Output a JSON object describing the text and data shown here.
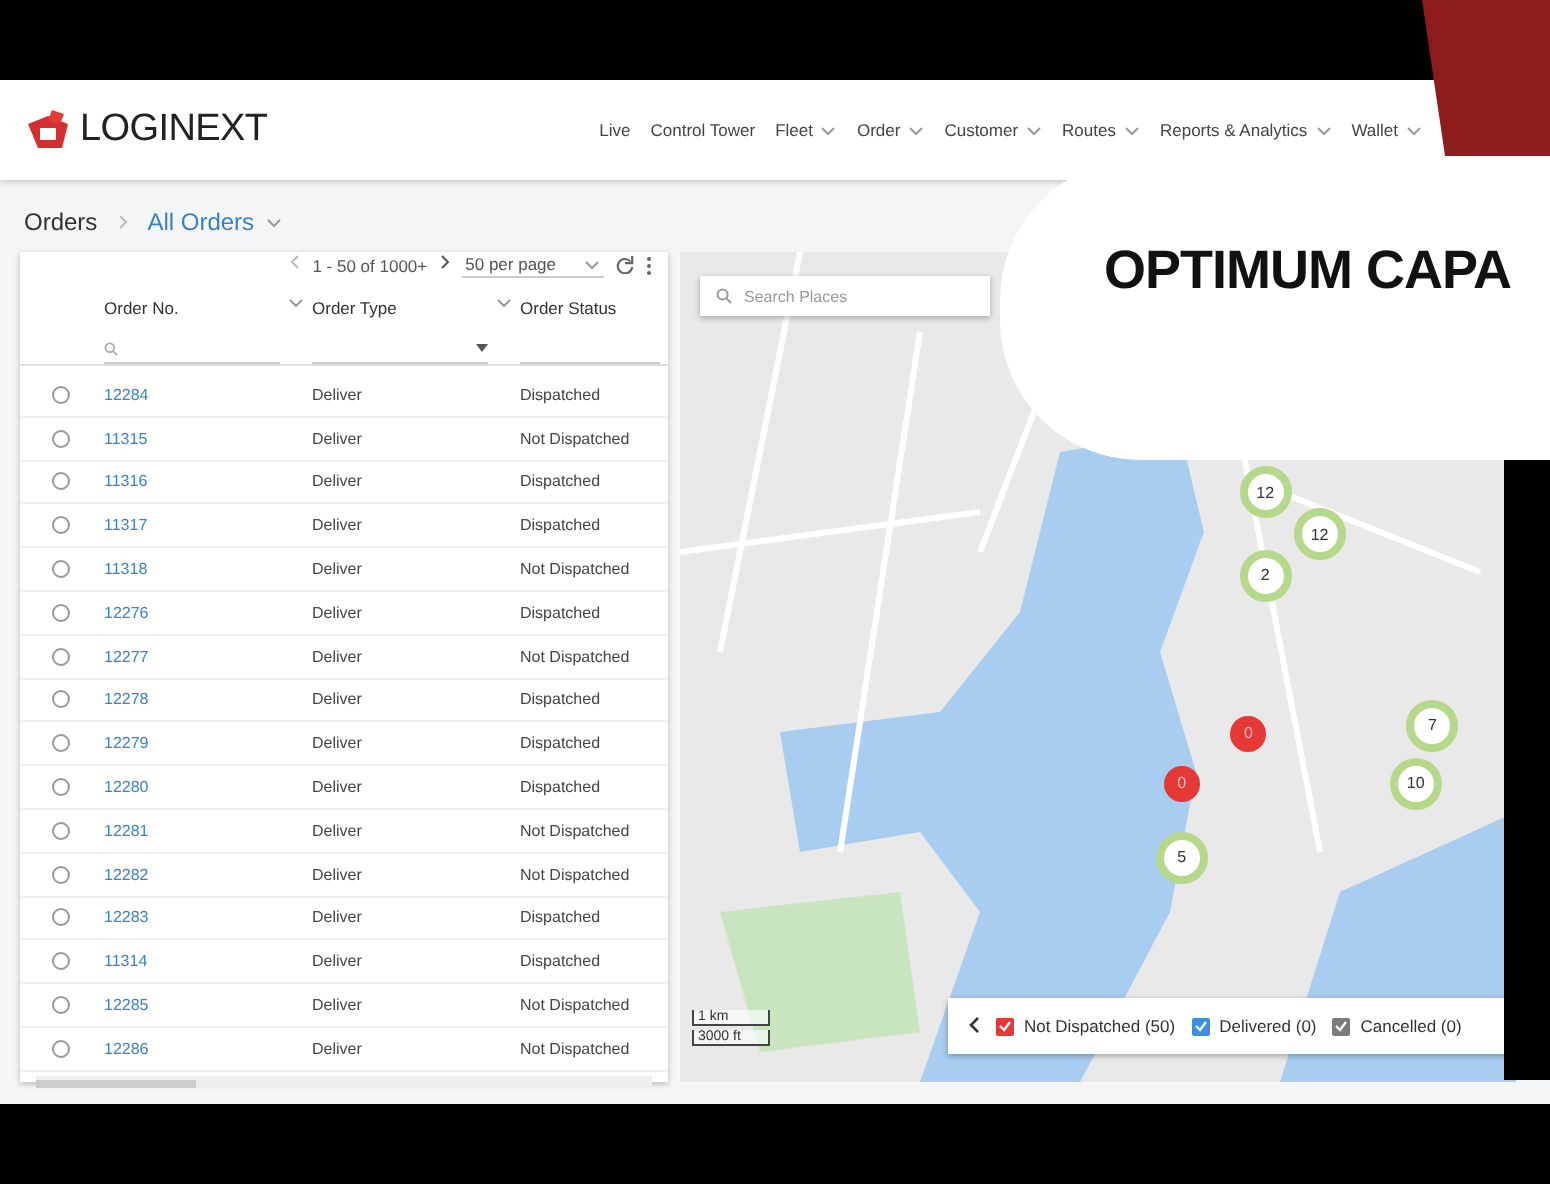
{
  "brand": {
    "name": "LOGINEXT"
  },
  "nav": [
    {
      "label": "Live",
      "dropdown": false
    },
    {
      "label": "Control Tower",
      "dropdown": false
    },
    {
      "label": "Fleet",
      "dropdown": true
    },
    {
      "label": "Order",
      "dropdown": true
    },
    {
      "label": "Customer",
      "dropdown": true
    },
    {
      "label": "Routes",
      "dropdown": true
    },
    {
      "label": "Reports & Analytics",
      "dropdown": true
    },
    {
      "label": "Wallet",
      "dropdown": true
    }
  ],
  "breadcrumb": {
    "root": "Orders",
    "current": "All Orders"
  },
  "pagination": {
    "range": "1 - 50 of 1000+",
    "per_page": "50 per page"
  },
  "table": {
    "columns": [
      {
        "label": "Order No."
      },
      {
        "label": "Order Type"
      },
      {
        "label": "Order Status"
      }
    ],
    "rows": [
      {
        "selected": false,
        "order_no": "12284",
        "type": "Deliver",
        "status": "Dispatched"
      },
      {
        "selected": false,
        "order_no": "11315",
        "type": "Deliver",
        "status": "Not Dispatched"
      },
      {
        "selected": false,
        "order_no": "11316",
        "type": "Deliver",
        "status": "Dispatched"
      },
      {
        "selected": false,
        "order_no": "11317",
        "type": "Deliver",
        "status": "Dispatched"
      },
      {
        "selected": false,
        "order_no": "11318",
        "type": "Deliver",
        "status": "Not Dispatched"
      },
      {
        "selected": false,
        "order_no": "12276",
        "type": "Deliver",
        "status": "Dispatched"
      },
      {
        "selected": false,
        "order_no": "12277",
        "type": "Deliver",
        "status": "Not Dispatched"
      },
      {
        "selected": false,
        "order_no": "12278",
        "type": "Deliver",
        "status": "Dispatched"
      },
      {
        "selected": false,
        "order_no": "12279",
        "type": "Deliver",
        "status": "Dispatched"
      },
      {
        "selected": false,
        "order_no": "12280",
        "type": "Deliver",
        "status": "Dispatched"
      },
      {
        "selected": false,
        "order_no": "12281",
        "type": "Deliver",
        "status": "Not Dispatched"
      },
      {
        "selected": false,
        "order_no": "12282",
        "type": "Deliver",
        "status": "Not Dispatched"
      },
      {
        "selected": false,
        "order_no": "12283",
        "type": "Deliver",
        "status": "Dispatched"
      },
      {
        "selected": false,
        "order_no": "11314",
        "type": "Deliver",
        "status": "Dispatched"
      },
      {
        "selected": false,
        "order_no": "12285",
        "type": "Deliver",
        "status": "Not Dispatched"
      },
      {
        "selected": false,
        "order_no": "12286",
        "type": "Deliver",
        "status": "Not Dispatched"
      }
    ]
  },
  "map": {
    "search": {
      "placeholder": "Search Places"
    },
    "clusters": [
      {
        "count": "12",
        "kind": "group"
      },
      {
        "count": "12",
        "kind": "group"
      },
      {
        "count": "2",
        "kind": "group"
      },
      {
        "count": "7",
        "kind": "group"
      },
      {
        "count": "10",
        "kind": "group"
      },
      {
        "count": "0",
        "kind": "alert"
      },
      {
        "count": "0",
        "kind": "alert"
      },
      {
        "count": "5",
        "kind": "group"
      }
    ],
    "scale": [
      "1 km",
      "3000 ft"
    ],
    "legend": [
      {
        "label": "Not Dispatched (50)",
        "checked": true,
        "color": "#e53935"
      },
      {
        "label": "Delivered (0)",
        "checked": true,
        "color": "#3b8fde"
      },
      {
        "label": "Cancelled (0)",
        "checked": true,
        "color": "#7a7a7a"
      }
    ]
  },
  "banner": {
    "headline": "OPTIMUM CAPA"
  }
}
